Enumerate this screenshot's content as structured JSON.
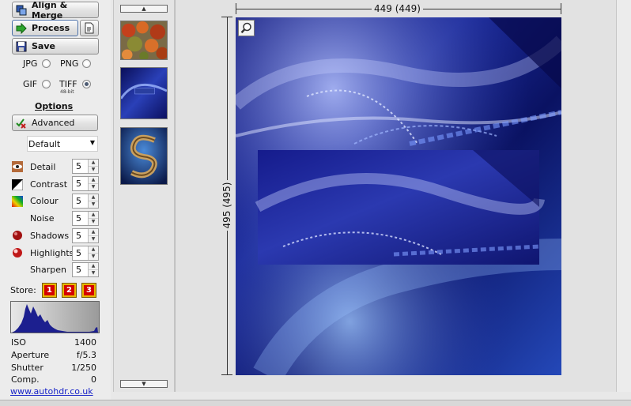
{
  "toolbar": {
    "align_merge_label": "Align & Merge",
    "process_label": "Process",
    "save_label": "Save"
  },
  "formats": {
    "jpg": "JPG",
    "png": "PNG",
    "gif": "GIF",
    "tiff": "TIFF",
    "tiff_sub": "48-bit",
    "selected": "TIFF"
  },
  "options": {
    "heading": "Options",
    "advanced_label": "Advanced",
    "preset": "Default"
  },
  "adjustments": [
    {
      "label": "Detail",
      "value": "5"
    },
    {
      "label": "Contrast",
      "value": "5"
    },
    {
      "label": "Colour",
      "value": "5"
    },
    {
      "label": "Noise",
      "value": "5"
    },
    {
      "label": "Shadows",
      "value": "5"
    },
    {
      "label": "Highlights",
      "value": "5"
    },
    {
      "label": "Sharpen",
      "value": "5"
    }
  ],
  "store": {
    "label": "Store:",
    "slots": [
      "1",
      "2",
      "3"
    ]
  },
  "exif": [
    {
      "key": "ISO",
      "value": "1400"
    },
    {
      "key": "Aperture",
      "value": "f/5.3"
    },
    {
      "key": "Shutter",
      "value": "1/250"
    },
    {
      "key": "Comp.",
      "value": "0"
    }
  ],
  "link": "www.autohdr.co.uk",
  "preview": {
    "width_label": "449 (449)",
    "height_label": "495 (495)"
  },
  "colors": {
    "accent_blue": "#1a1f8a",
    "store_red": "#d40000",
    "store_gold": "#e8b800"
  }
}
